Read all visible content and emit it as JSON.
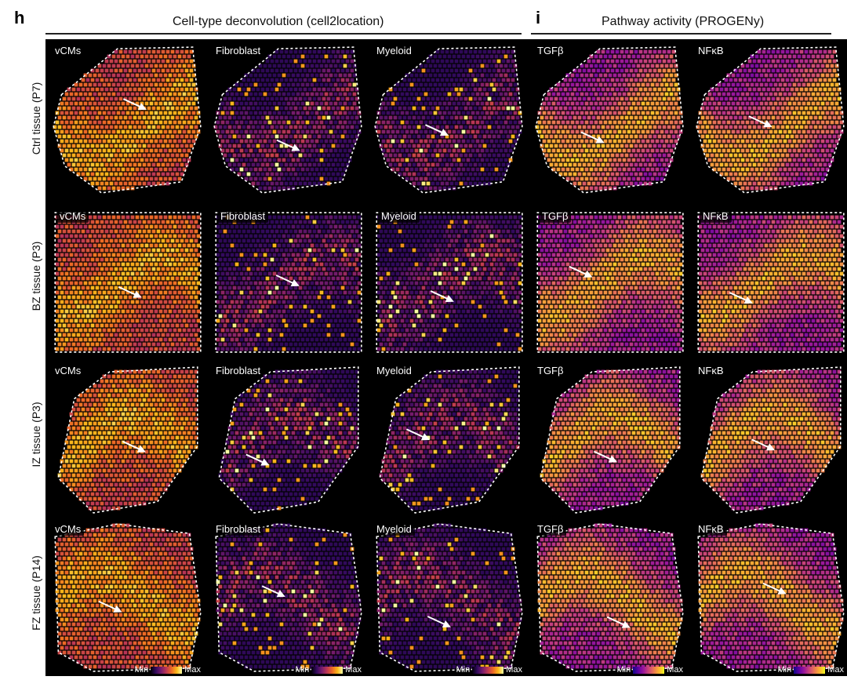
{
  "panel_h": {
    "letter": "h",
    "title": "Cell-type deconvolution (cell2location)"
  },
  "panel_i": {
    "letter": "i",
    "title": "Pathway activity (PROGENy)"
  },
  "rows": [
    {
      "label": "Ctrl tissue (P7)"
    },
    {
      "label": "BZ tissue (P3)"
    },
    {
      "label": "IZ tissue (P3)"
    },
    {
      "label": "FZ tissue (P14)"
    }
  ],
  "columns": [
    {
      "label": "vCMs",
      "colormap": "inferno"
    },
    {
      "label": "Fibroblast",
      "colormap": "inferno"
    },
    {
      "label": "Myeloid",
      "colormap": "inferno"
    },
    {
      "label": "TGFβ",
      "colormap": "plasma"
    },
    {
      "label": "NFκB",
      "colormap": "plasma"
    }
  ],
  "scale": {
    "min": "Min",
    "max": "Max"
  },
  "colors": {
    "inferno": [
      "#000004",
      "#320a5e",
      "#781c6d",
      "#bc3754",
      "#ed6925",
      "#fbb61a",
      "#fcffa4"
    ],
    "plasma": [
      "#0d0887",
      "#5b02a3",
      "#9a179b",
      "#cb4678",
      "#eb7852",
      "#fbb32f",
      "#f0f921"
    ]
  }
}
